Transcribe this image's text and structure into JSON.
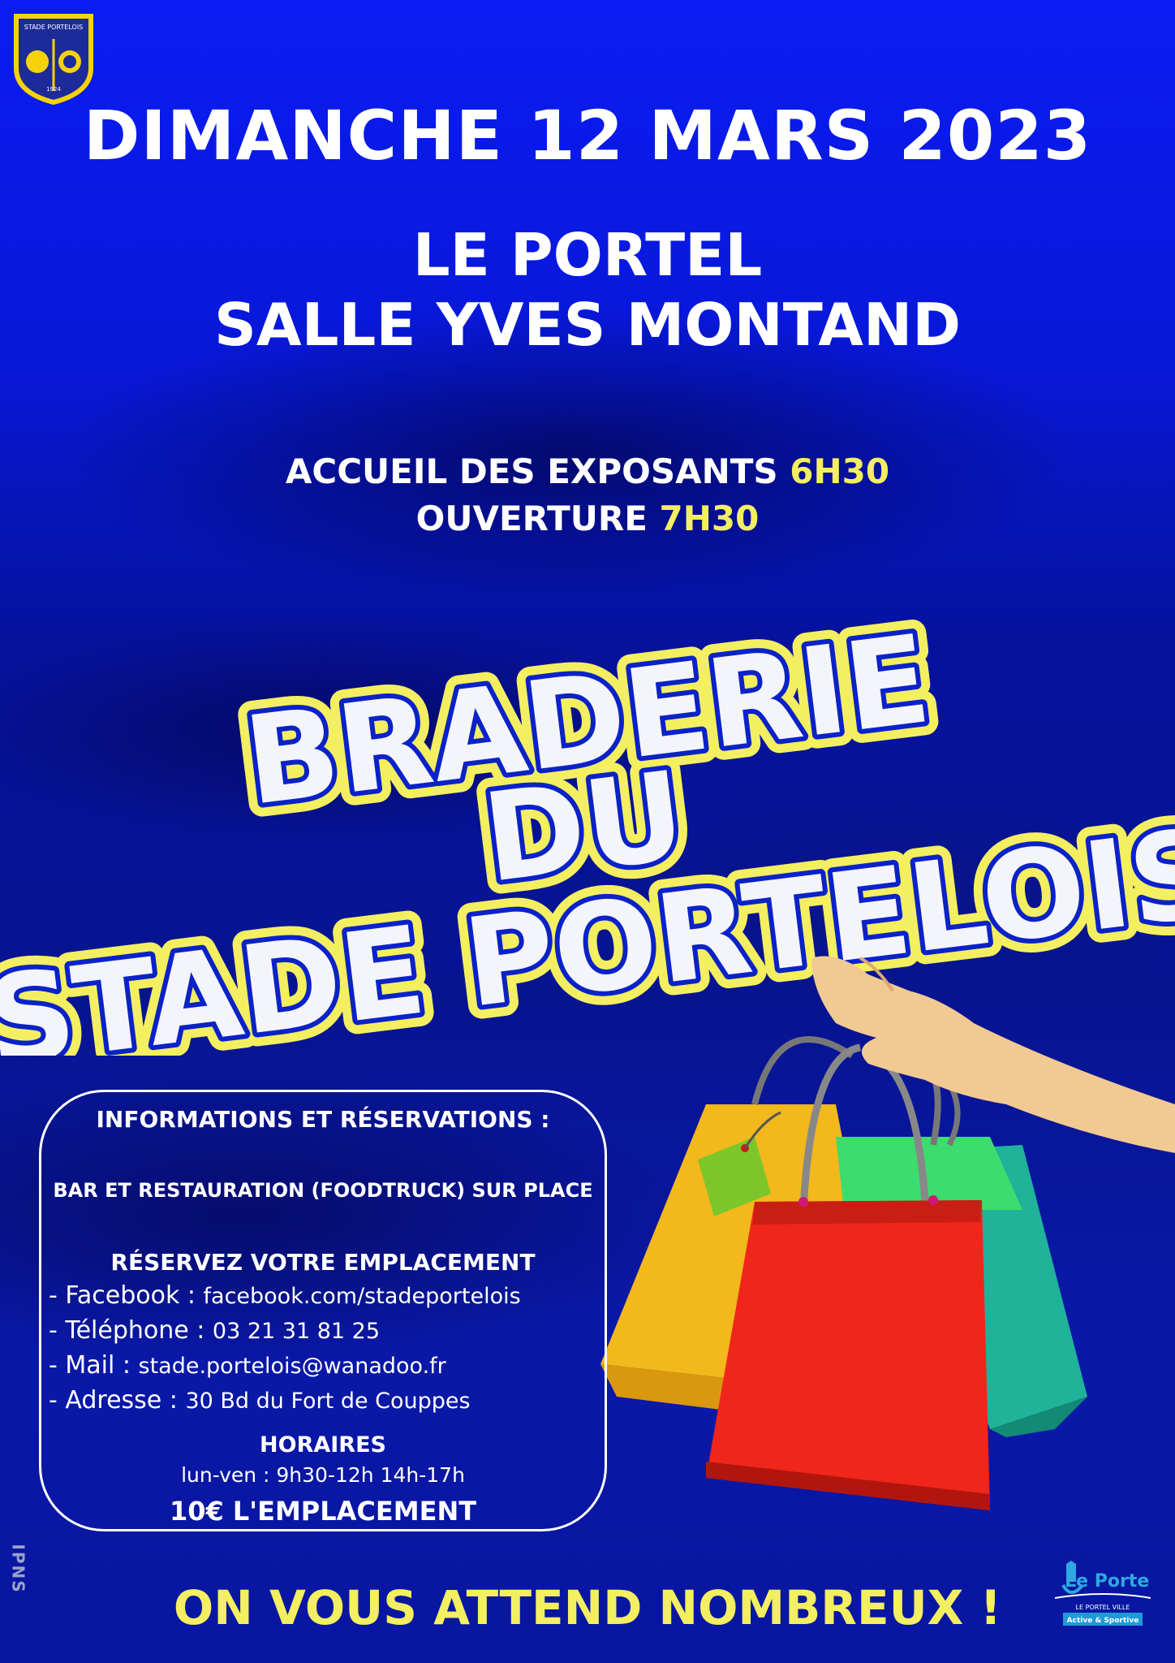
{
  "logo": {
    "name": "STADE PORTELOIS",
    "year": "1924"
  },
  "date": "DIMANCHE 12 MARS 2023",
  "location": {
    "line1": "LE PORTEL",
    "line2": "SALLE YVES MONTAND"
  },
  "schedule": {
    "exhibitors_label": "ACCUEIL DES EXPOSANTS",
    "exhibitors_time": "6H30",
    "opening_label": "OUVERTURE",
    "opening_time": "7H30"
  },
  "title": {
    "line1": "BRADERIE",
    "line2": "DU",
    "line3": "STADE PORTELOIS"
  },
  "info": {
    "heading": "INFORMATIONS ET RÉSERVATIONS :",
    "bar": "BAR ET RESTAURATION (FOODTRUCK) SUR PLACE",
    "reserve": "RÉSERVEZ VOTRE EMPLACEMENT",
    "facebook_label": "- Facebook :",
    "facebook_value": "facebook.com/stadeportelois",
    "phone_label": "- Téléphone :",
    "phone_value": "03 21 31 81 25",
    "mail_label": "- Mail :",
    "mail_value": "stade.portelois@wanadoo.fr",
    "address_label": "- Adresse :",
    "address_value": "30 Bd du Fort de Couppes",
    "hours_heading": "HORAIRES",
    "hours": "lun-ven : 9h30-12h   14h-17h",
    "price": "10€ L'EMPLACEMENT"
  },
  "footer": "ON VOUS ATTEND NOMBREUX !",
  "side_text": "IPNS",
  "town_logo": {
    "name": "Le Portel",
    "tagline": "LE PORTEL VILLE",
    "badge": "Active & Sportive"
  },
  "colors": {
    "background": "#0a1cf2",
    "accent_yellow": "#f3ef60",
    "title_outline": "#0a22c8"
  }
}
